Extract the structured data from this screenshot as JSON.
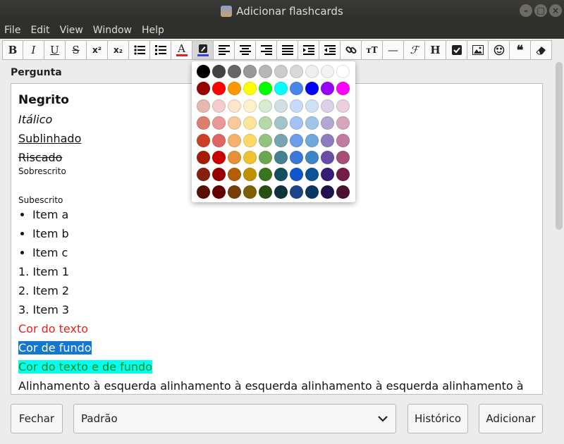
{
  "window": {
    "title": "Adicionar flashcards"
  },
  "menu": [
    "File",
    "Edit",
    "View",
    "Window",
    "Help"
  ],
  "toolbar": {
    "bold": "B",
    "italic": "I",
    "underline": "U",
    "strike": "S",
    "superscript": "x²",
    "subscript": "x₂",
    "fontsize": "ᴛT",
    "hr": "—",
    "formula": "ℱ",
    "heading": "H",
    "quote": "❝"
  },
  "field": {
    "label": "Pergunta"
  },
  "editor": {
    "bold": "Negrito",
    "italic": "Itálico",
    "underline": "Sublinhado",
    "strike": "Riscado",
    "superscript": "Sobrescrito",
    "subscript": "Subescrito",
    "bullets": [
      "Item a",
      "Item b",
      "Item c"
    ],
    "numbered": [
      "1. Item 1",
      "2. Item 2",
      "3. Item 3"
    ],
    "text_color": "Cor do texto",
    "bg_color": "Cor de fundo",
    "both_color": "Cor do texto e de fundo",
    "align": "Alinhamento à esquerda alinhamento à esquerda alinhamento à esquerda alinhamento à"
  },
  "colors": {
    "text_color_accent": "#e8201c",
    "palette": [
      [
        "#000000",
        "#434343",
        "#666666",
        "#999999",
        "#b7b7b7",
        "#cccccc",
        "#d9d9d9",
        "#efefef",
        "#f3f3f3",
        "#ffffff"
      ],
      [
        "#980000",
        "#ff0000",
        "#ff9900",
        "#ffff00",
        "#00ff00",
        "#00ffff",
        "#4a86e8",
        "#0000ff",
        "#9900ff",
        "#ff00ff"
      ],
      [
        "#e6b8af",
        "#f4cccc",
        "#fce5cd",
        "#fff2cc",
        "#d9ead3",
        "#d0e0e3",
        "#c9daf8",
        "#cfe2f3",
        "#d9d2e9",
        "#ead1dc"
      ],
      [
        "#dd7e6b",
        "#ea9999",
        "#f9cb9c",
        "#ffe599",
        "#b6d7a8",
        "#a2c4c9",
        "#a4c2f4",
        "#9fc5e8",
        "#b4a7d6",
        "#d5a6bd"
      ],
      [
        "#cc4125",
        "#e06666",
        "#f6b26b",
        "#ffd966",
        "#93c47d",
        "#76a5af",
        "#6d9eeb",
        "#6fa8dc",
        "#8e7cc3",
        "#c27ba0"
      ],
      [
        "#a61c00",
        "#cc0000",
        "#e69138",
        "#f1c232",
        "#6aa84f",
        "#45818e",
        "#3c78d8",
        "#3d85c6",
        "#674ea7",
        "#a64d79"
      ],
      [
        "#85200c",
        "#990000",
        "#b45f06",
        "#bf9000",
        "#38761d",
        "#134f5c",
        "#1155cc",
        "#0b5394",
        "#351c75",
        "#741b47"
      ],
      [
        "#5b0f00",
        "#660000",
        "#783f04",
        "#7f6000",
        "#274e13",
        "#0c343d",
        "#1c4587",
        "#073763",
        "#20124d",
        "#4c1130"
      ]
    ]
  },
  "buttons": {
    "close": "Fechar",
    "deck": "Padrão",
    "history": "Histórico",
    "add": "Adicionar"
  }
}
